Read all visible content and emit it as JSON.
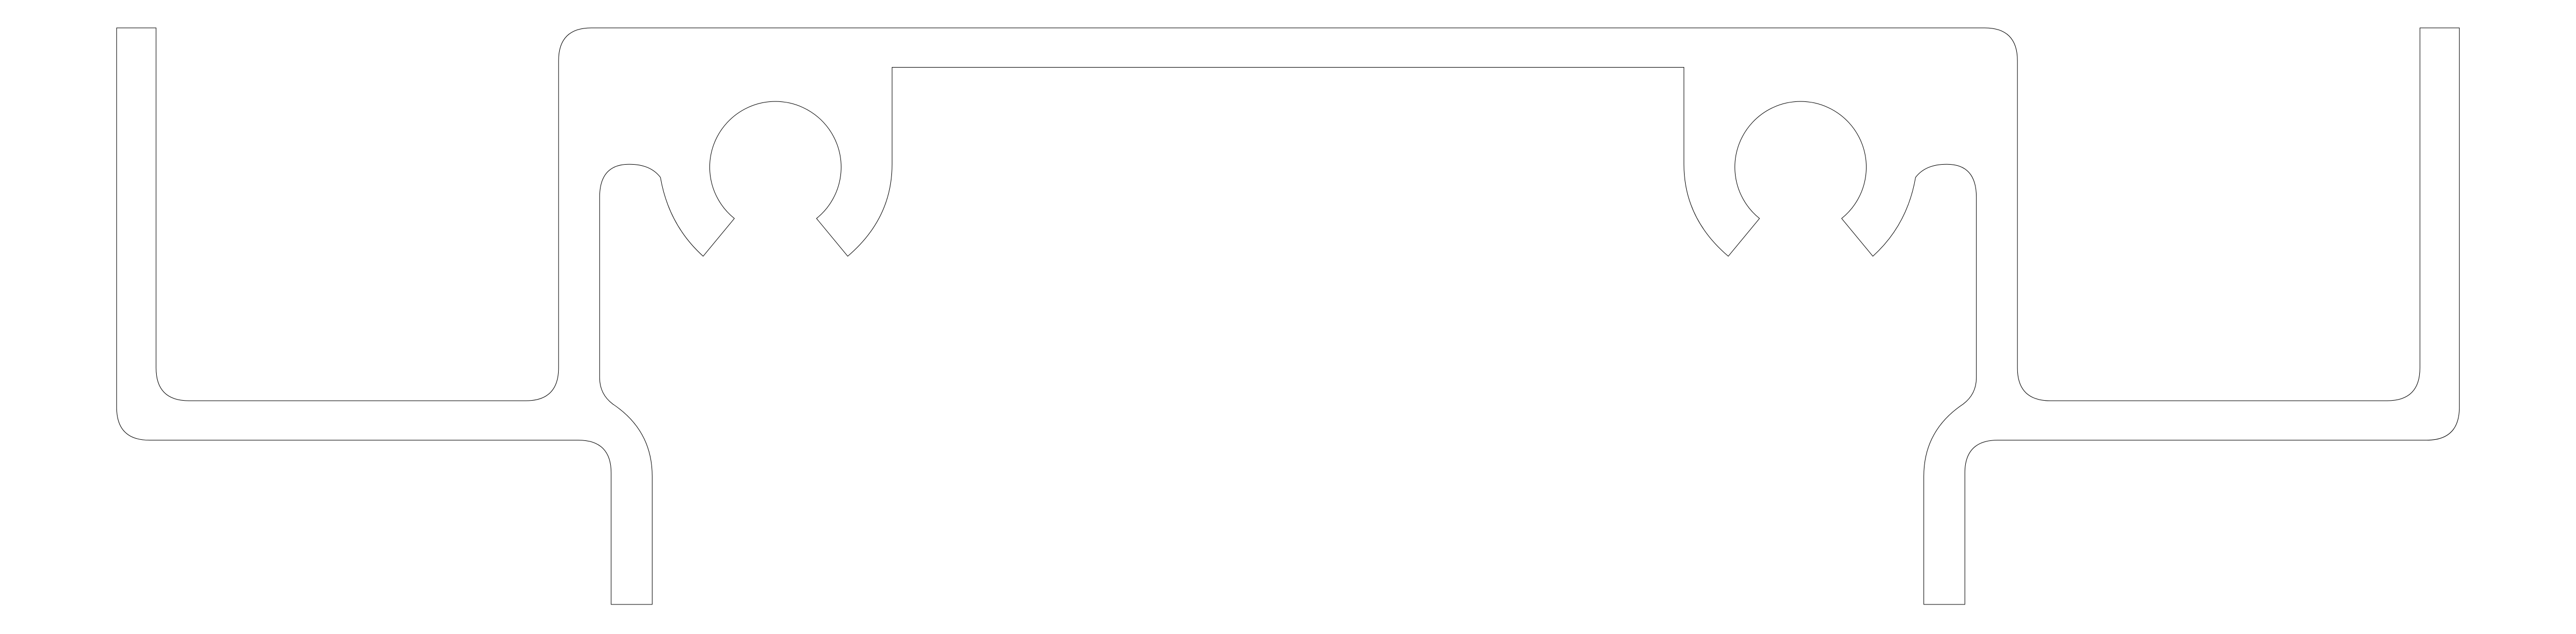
{
  "drawing": {
    "background_color": "#ffffff",
    "line_color": "#000000",
    "type": "extrusion-profile-cross-section",
    "symmetry": "mirror-about-vertical-center",
    "features": [
      "left-wing",
      "right-wing",
      "center-channel",
      "left-circular-groove",
      "right-circular-groove",
      "left-leg",
      "right-leg"
    ]
  }
}
